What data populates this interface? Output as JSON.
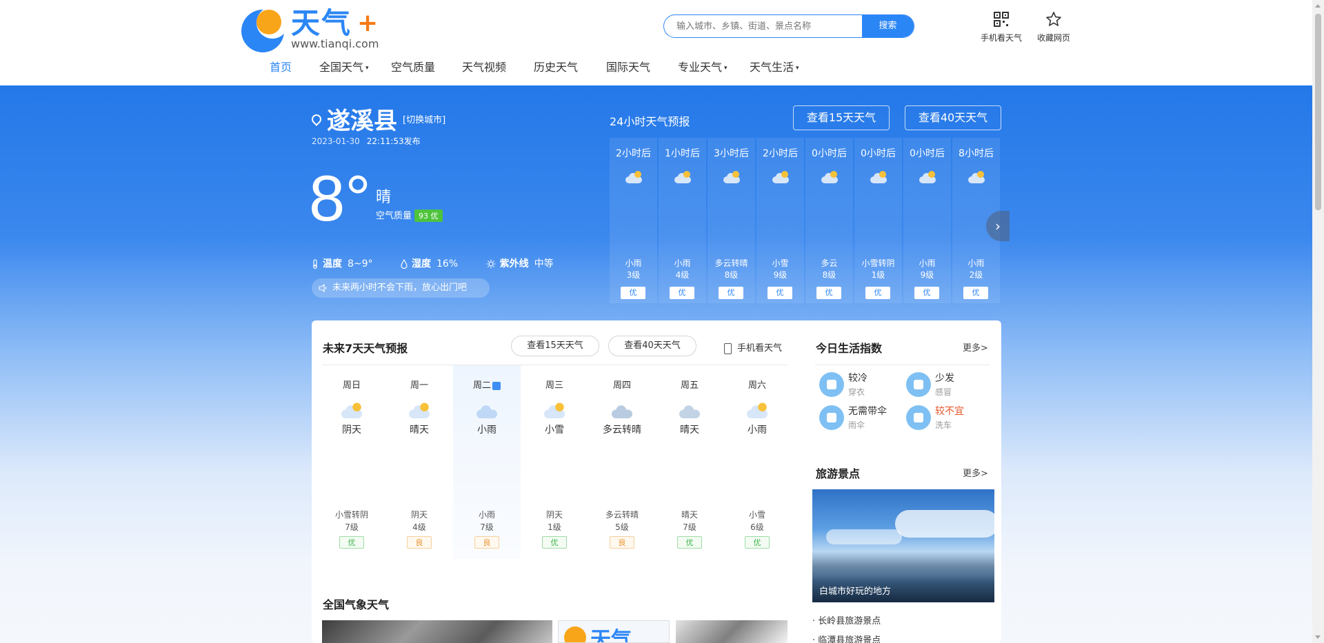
{
  "header": {
    "logo_text": "天气",
    "logo_plus": "+",
    "logo_url": "www.tianqi.com",
    "search_placeholder": "输入城市、乡镇、街道、景点名称",
    "search_button": "搜索",
    "mobile_weather": "手机看天气",
    "bookmark": "收藏网页"
  },
  "nav": {
    "items": [
      "首页",
      "全国天气",
      "空气质量",
      "天气视频",
      "历史天气",
      "国际天气",
      "专业天气",
      "天气生活"
    ],
    "caret": "▾"
  },
  "current": {
    "city": "遂溪县",
    "switch_city": "[切换城市]",
    "date": "2023-01-30",
    "time": "22:11:53发布",
    "temp": "8°",
    "weather": "晴",
    "aqi_label": "空气质量",
    "aqi_value": "93 优",
    "temp_label": "温度",
    "temp_range": "8~9°",
    "humidity_label": "湿度",
    "humidity": "16%",
    "uv_label": "紫外线",
    "uv": "中等",
    "tip": "未来两小时不会下雨，放心出门吧"
  },
  "hourly": {
    "title": "24小时天气预报",
    "btn15": "查看15天天气",
    "btn40": "查看40天天气",
    "next": "›",
    "items": [
      {
        "time": "2小时后",
        "desc": "小雨",
        "wind": "3级",
        "aq": "优"
      },
      {
        "time": "1小时后",
        "desc": "小雨",
        "wind": "4级",
        "aq": "优"
      },
      {
        "time": "3小时后",
        "desc": "多云转晴",
        "wind": "8级",
        "aq": "优"
      },
      {
        "time": "2小时后",
        "desc": "小雪",
        "wind": "9级",
        "aq": "优"
      },
      {
        "time": "0小时后",
        "desc": "多云",
        "wind": "8级",
        "aq": "优"
      },
      {
        "time": "0小时后",
        "desc": "小雪转阴",
        "wind": "1级",
        "aq": "优"
      },
      {
        "time": "0小时后",
        "desc": "小雨",
        "wind": "9级",
        "aq": "优"
      },
      {
        "time": "8小时后",
        "desc": "小雨",
        "wind": "2级",
        "aq": "优"
      }
    ]
  },
  "week": {
    "title": "未来7天天气预报",
    "btn15": "查看15天天气",
    "btn40": "查看40天天气",
    "mobile": "手机看天气",
    "days": [
      {
        "wd": "周日",
        "day": "阴天",
        "night": "小雪转阴",
        "wind": "7级",
        "aq": "优"
      },
      {
        "wd": "周一",
        "day": "晴天",
        "night": "阴天",
        "wind": "4级",
        "aq": "良"
      },
      {
        "wd": "周二",
        "day": "小雨",
        "night": "小雨",
        "wind": "7级",
        "aq": "良"
      },
      {
        "wd": "周三",
        "day": "小雪",
        "night": "阴天",
        "wind": "1级",
        "aq": "优"
      },
      {
        "wd": "周四",
        "day": "多云转晴",
        "night": "多云转晴",
        "wind": "5级",
        "aq": "良"
      },
      {
        "wd": "周五",
        "day": "晴天",
        "night": "晴天",
        "wind": "7级",
        "aq": "优"
      },
      {
        "wd": "周六",
        "day": "小雨",
        "night": "小雪",
        "wind": "6级",
        "aq": "优"
      }
    ]
  },
  "life": {
    "title": "今日生活指数",
    "more": "更多>",
    "items": [
      {
        "value": "较冷",
        "key": "穿衣"
      },
      {
        "value": "少发",
        "key": "感冒"
      },
      {
        "value": "无需带伞",
        "key": "雨伞"
      },
      {
        "value": "较不宜",
        "key": "洗车"
      }
    ]
  },
  "travel": {
    "title": "旅游景点",
    "more": "更多>",
    "caption": "白城市好玩的地方",
    "links": [
      "· 长岭县旅游景点",
      "· 临潭县旅游景点"
    ]
  },
  "national": {
    "title": "全国气象天气"
  },
  "colors": {
    "brand": "#2b86f5",
    "good": "#3bb54a",
    "mid": "#e9922d",
    "warn": "#e8572b"
  }
}
